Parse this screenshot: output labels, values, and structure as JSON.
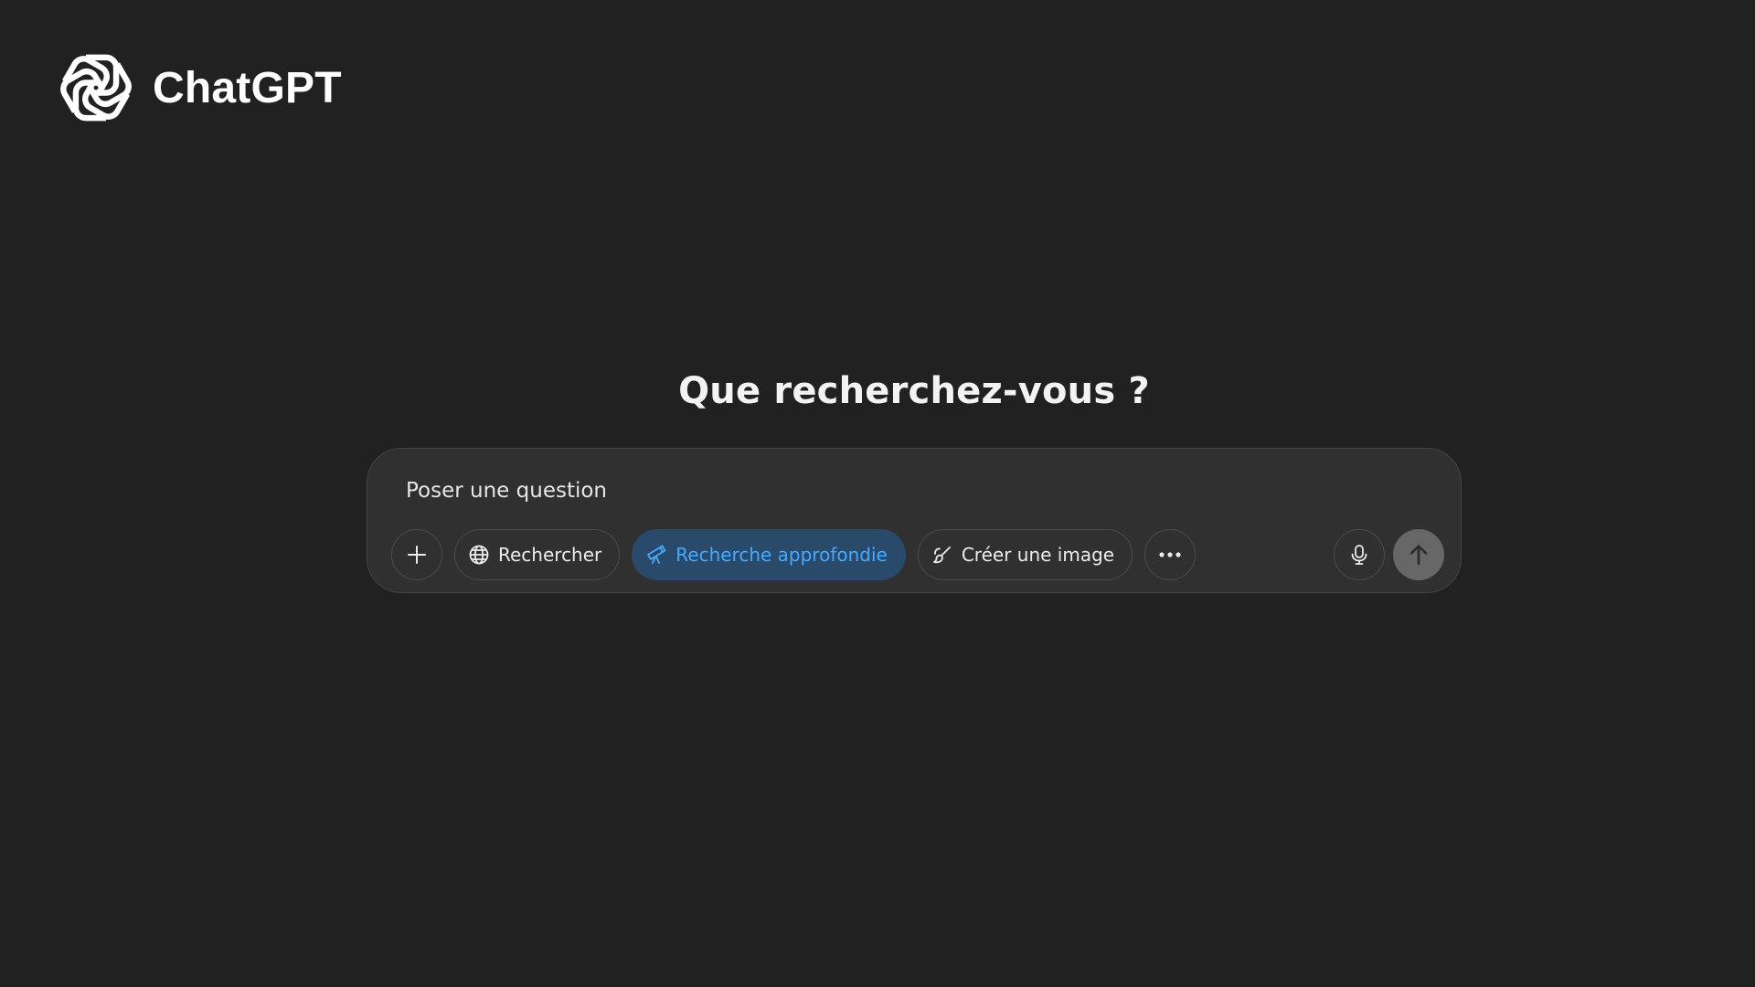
{
  "brand": {
    "name": "ChatGPT",
    "logo_icon": "openai-logo-icon"
  },
  "main": {
    "heading": "Que recherchez-vous ?"
  },
  "composer": {
    "placeholder": "Poser une question",
    "value": "",
    "tools": {
      "attach_icon": "plus-icon",
      "search": {
        "label": "Rechercher",
        "icon": "globe-icon",
        "active": false
      },
      "deep_research": {
        "label": "Recherche approfondie",
        "icon": "telescope-icon",
        "active": true
      },
      "create_image": {
        "label": "Créer une image",
        "icon": "paint-brush-icon",
        "active": false
      },
      "more_icon": "ellipsis-icon"
    },
    "mic_icon": "microphone-icon",
    "send_icon": "arrow-up-icon"
  },
  "colors": {
    "background": "#212121",
    "composer_bg": "#303030",
    "active_pill_bg": "#2a4a6b",
    "active_pill_text": "#48aaff",
    "send_button": "#676767"
  }
}
